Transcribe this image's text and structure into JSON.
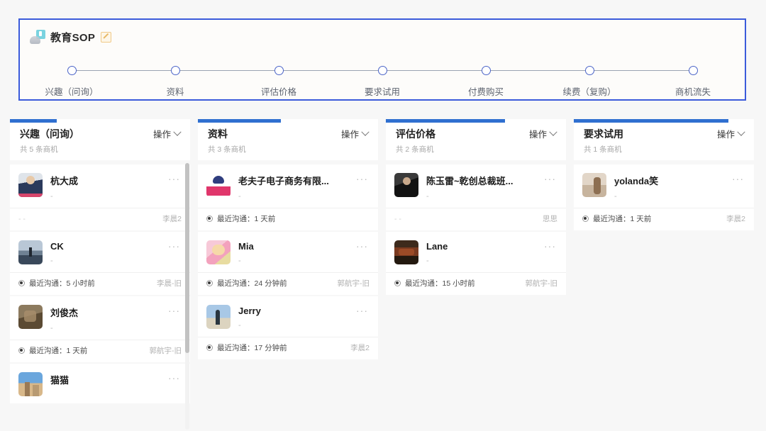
{
  "header": {
    "title": "教育SOP",
    "logo_icon": "education-sop-icon",
    "edit_icon": "edit-pencil-icon",
    "stages": [
      {
        "label": "兴趣（问询）"
      },
      {
        "label": "资料"
      },
      {
        "label": "评估价格"
      },
      {
        "label": "要求试用"
      },
      {
        "label": "付费购买"
      },
      {
        "label": "续费（复购）"
      },
      {
        "label": "商机流失"
      }
    ]
  },
  "colors": {
    "accent_border": "#3b5bdb",
    "progress": "#2f6fd0",
    "page_bg": "#f7f7f7",
    "card_bg": "#ffffff"
  },
  "columns": [
    {
      "title": "兴趣（问询）",
      "count_text": "共 5 条商机",
      "action_label": "操作",
      "progress_width": "26%",
      "has_scrollbar": true,
      "cards": [
        {
          "name": "杭大成",
          "desc": "-",
          "menu": "···",
          "avatar": "av-suit",
          "footer_left": "- -",
          "footer_has_dot": false,
          "owner": "李晨2"
        },
        {
          "name": "CK",
          "desc": "-",
          "menu": "···",
          "avatar": "av-lake",
          "footer_left": "最近沟通：5 小时前",
          "footer_has_dot": true,
          "owner": "李晨-旧"
        },
        {
          "name": "刘俊杰",
          "desc": "-",
          "menu": "···",
          "avatar": "av-brown",
          "footer_left": "最近沟通：1 天前",
          "footer_has_dot": true,
          "owner": "郭航宇-旧"
        },
        {
          "name": "猫猫",
          "desc": "",
          "menu": "···",
          "avatar": "av-city",
          "footer_left": "",
          "footer_has_dot": false,
          "owner": ""
        }
      ]
    },
    {
      "title": "资料",
      "count_text": "共 3 条商机",
      "action_label": "操作",
      "progress_width": "46%",
      "has_scrollbar": false,
      "cards": [
        {
          "name": "老夫子电子商务有限...",
          "desc": "-",
          "menu": "···",
          "avatar": "av-logo",
          "footer_left": "最近沟通：1 天前",
          "footer_has_dot": true,
          "owner": ""
        },
        {
          "name": "Mia",
          "desc": "-",
          "menu": "···",
          "avatar": "av-anime",
          "footer_left": "最近沟通：24 分钟前",
          "footer_has_dot": true,
          "owner": "郭航宇-旧"
        },
        {
          "name": "Jerry",
          "desc": "-",
          "menu": "···",
          "avatar": "av-beach",
          "footer_left": "最近沟通：17 分钟前",
          "footer_has_dot": true,
          "owner": "李晨2"
        }
      ]
    },
    {
      "title": "评估价格",
      "count_text": "共 2 条商机",
      "action_label": "操作",
      "progress_width": "66%",
      "has_scrollbar": false,
      "cards": [
        {
          "name": "陈玉雷~乾创总裁班...",
          "desc": "-",
          "menu": "···",
          "avatar": "av-dark",
          "footer_left": "- -",
          "footer_has_dot": false,
          "owner": "思思"
        },
        {
          "name": "Lane",
          "desc": "-",
          "menu": "···",
          "avatar": "av-autumn",
          "footer_left": "最近沟通：15 小时前",
          "footer_has_dot": true,
          "owner": "郭航宇-旧"
        }
      ]
    },
    {
      "title": "要求试用",
      "count_text": "共 1 条商机",
      "action_label": "操作",
      "progress_width": "86%",
      "has_scrollbar": false,
      "cards": [
        {
          "name": "yolanda笑",
          "desc": "-",
          "menu": "···",
          "avatar": "av-room",
          "footer_left": "最近沟通：1 天前",
          "footer_has_dot": true,
          "owner": "李晨2"
        }
      ]
    }
  ]
}
